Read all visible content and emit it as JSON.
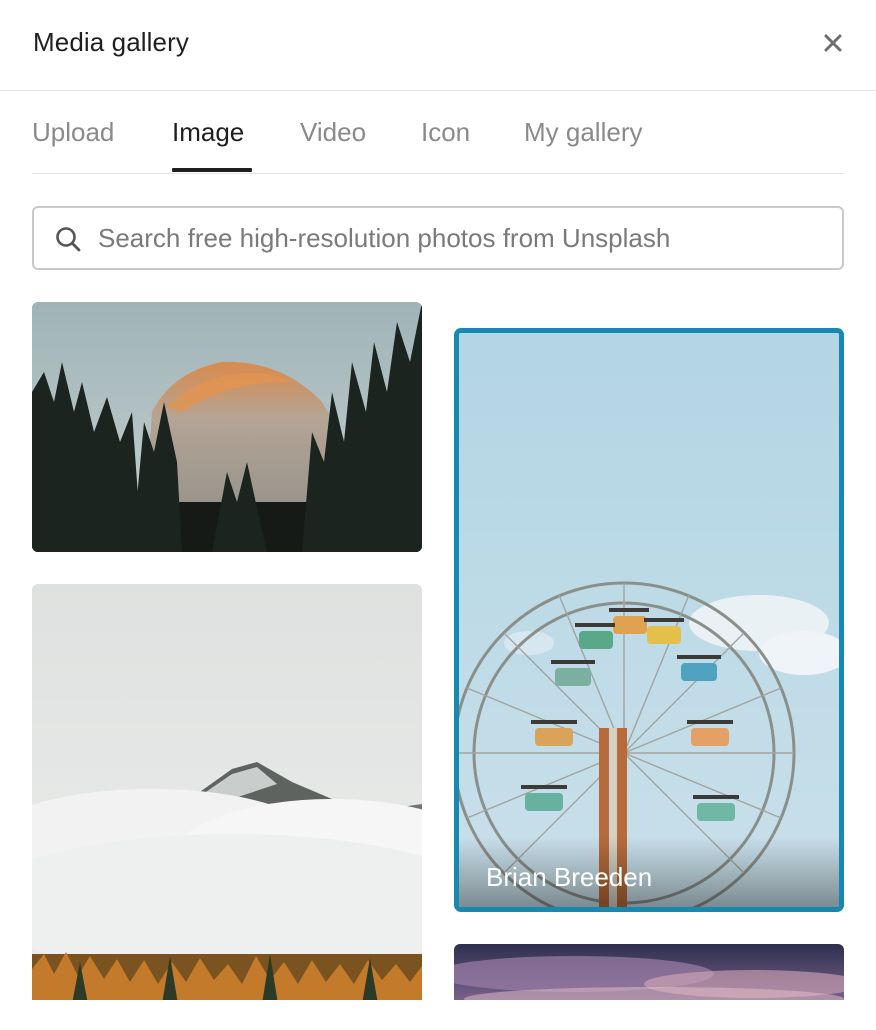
{
  "header": {
    "title": "Media gallery",
    "close_icon": "close-icon"
  },
  "tabs": [
    {
      "label": "Upload",
      "active": false
    },
    {
      "label": "Image",
      "active": true
    },
    {
      "label": "Video",
      "active": false
    },
    {
      "label": "Icon",
      "active": false
    },
    {
      "label": "My gallery",
      "active": false
    }
  ],
  "search": {
    "icon": "search-icon",
    "placeholder": "Search free high-resolution photos from Unsplash",
    "value": ""
  },
  "gallery": {
    "selected_border_color": "#1789b0",
    "items": [
      {
        "subject": "granite dome mountain at sunset with pine trees",
        "author": ""
      },
      {
        "subject": "snowy mountain peak in clouds with autumn forest",
        "author": ""
      },
      {
        "subject": "ferris wheel against blue sky",
        "author": "Brian Breeden",
        "selected": true
      },
      {
        "subject": "dusky purple and pink sky",
        "author": ""
      }
    ]
  }
}
